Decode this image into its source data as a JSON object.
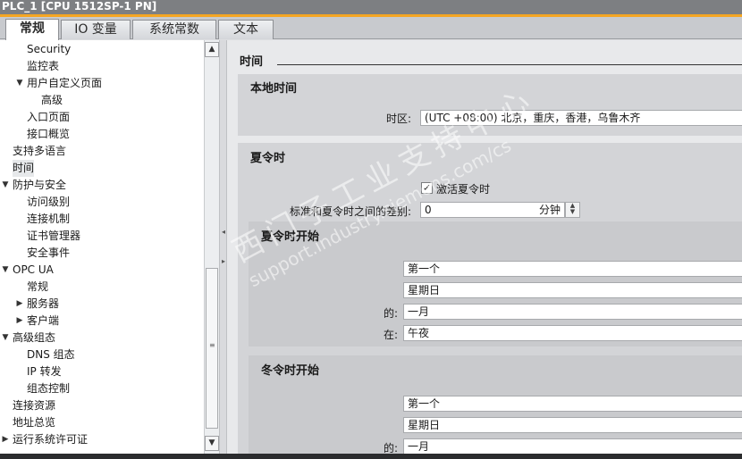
{
  "window": {
    "title": "PLC_1 [CPU 1512SP-1 PN]"
  },
  "tabs": [
    {
      "label": "常规",
      "active": true
    },
    {
      "label": "IO 变量",
      "active": false
    },
    {
      "label": "系统常数",
      "active": false
    },
    {
      "label": "文本",
      "active": false
    }
  ],
  "tree": [
    {
      "label": "Security",
      "level": 2,
      "toggle": ""
    },
    {
      "label": "监控表",
      "level": 2,
      "toggle": ""
    },
    {
      "label": "用户自定义页面",
      "level": 2,
      "toggle": "▼"
    },
    {
      "label": "高级",
      "level": 3,
      "toggle": ""
    },
    {
      "label": "入口页面",
      "level": 2,
      "toggle": ""
    },
    {
      "label": "接口概览",
      "level": 2,
      "toggle": ""
    },
    {
      "label": "支持多语言",
      "level": 1,
      "toggle": ""
    },
    {
      "label": "时间",
      "level": 1,
      "toggle": "",
      "selected": true
    },
    {
      "label": "防护与安全",
      "level": 1,
      "toggle": "▼"
    },
    {
      "label": "访问级别",
      "level": 2,
      "toggle": ""
    },
    {
      "label": "连接机制",
      "level": 2,
      "toggle": ""
    },
    {
      "label": "证书管理器",
      "level": 2,
      "toggle": ""
    },
    {
      "label": "安全事件",
      "level": 2,
      "toggle": ""
    },
    {
      "label": "OPC UA",
      "level": 1,
      "toggle": "▼"
    },
    {
      "label": "常规",
      "level": 2,
      "toggle": ""
    },
    {
      "label": "服务器",
      "level": 2,
      "toggle": "▶"
    },
    {
      "label": "客户端",
      "level": 2,
      "toggle": "▶"
    },
    {
      "label": "高级组态",
      "level": 1,
      "toggle": "▼"
    },
    {
      "label": "DNS 组态",
      "level": 2,
      "toggle": ""
    },
    {
      "label": "IP 转发",
      "level": 2,
      "toggle": ""
    },
    {
      "label": "组态控制",
      "level": 2,
      "toggle": ""
    },
    {
      "label": "连接资源",
      "level": 1,
      "toggle": ""
    },
    {
      "label": "地址总览",
      "level": 1,
      "toggle": ""
    },
    {
      "label": "运行系统许可证",
      "level": 1,
      "toggle": "▶"
    }
  ],
  "main": {
    "section_title": "时间",
    "local_time": {
      "title": "本地时间",
      "timezone_label": "时区:",
      "timezone_value": "(UTC +08:00) 北京，重庆，香港，乌鲁木齐"
    },
    "dst": {
      "title": "夏令时",
      "activate_label": "激活夏令时",
      "activate_checked": "✓",
      "diff_label": "标准和夏令时之间的差别:",
      "diff_value": "0",
      "diff_unit": "分钟",
      "start": {
        "title": "夏令时开始",
        "week": "第一个",
        "weekday": "星期日",
        "month_label": "的:",
        "month": "一月",
        "at_label": "在:",
        "at": "午夜"
      },
      "end": {
        "title": "冬令时开始",
        "week": "第一个",
        "weekday": "星期日",
        "month_label": "的:",
        "month": "一月"
      }
    }
  },
  "watermark": {
    "line1": "西门子工业支持中心",
    "line2": "support.industry.siemens.com/cs"
  },
  "icons": {
    "scroll_up": "▲",
    "scroll_down": "▼",
    "grip": "≡",
    "spin_up": "▲",
    "spin_down": "▼"
  }
}
